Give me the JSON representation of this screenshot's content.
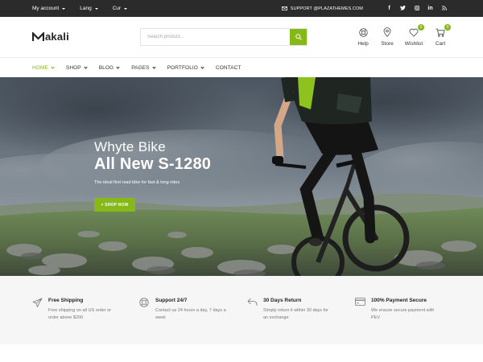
{
  "topbar": {
    "account_label": "My account",
    "lang_label": "Lang",
    "currency_label": "Cur",
    "support_text": "SUPPORT @PLAZATHEMES.COM",
    "social_icons": [
      "facebook-icon",
      "twitter-icon",
      "instagram-icon",
      "linkedin-icon",
      "rss-icon"
    ]
  },
  "header": {
    "logo_text": "akali",
    "search_placeholder": "Search product...",
    "actions": {
      "help": "Help",
      "store": "Store",
      "wishlist": "Wishlist",
      "wishlist_count": "0",
      "cart": "Cart",
      "cart_count": "0"
    }
  },
  "nav": {
    "items": [
      {
        "label": "HOME",
        "active": true,
        "dropdown": true
      },
      {
        "label": "SHOP",
        "active": false,
        "dropdown": true
      },
      {
        "label": "BLOG",
        "active": false,
        "dropdown": true
      },
      {
        "label": "PAGES",
        "active": false,
        "dropdown": true
      },
      {
        "label": "PORTFOLIO",
        "active": false,
        "dropdown": true
      },
      {
        "label": "CONTACT",
        "active": false,
        "dropdown": false
      }
    ]
  },
  "hero": {
    "subtitle": "Whyte Bike",
    "title": "All New S-1280",
    "description": "The ideal first road bike for fast & long rides",
    "button_label": "+ SHOP NOW"
  },
  "features": [
    {
      "icon": "plane-icon",
      "title": "Free Shipping",
      "line1": "Free shipping on all US order or",
      "line2": "order above $200"
    },
    {
      "icon": "lifebuoy-icon",
      "title": "Support 24/7",
      "line1": "Contact us 24 hours a day, 7 days a",
      "line2": "week"
    },
    {
      "icon": "return-icon",
      "title": "30 Days Return",
      "line1": "Simply return it within 30 days for",
      "line2": "an exchange"
    },
    {
      "icon": "credit-card-icon",
      "title": "100% Payment Secure",
      "line1": "We ensure secure payment with",
      "line2": "PEV"
    }
  ],
  "colors": {
    "accent": "#86b817",
    "topbar_bg": "#2b2b2b",
    "features_bg": "#f6f6f6"
  }
}
